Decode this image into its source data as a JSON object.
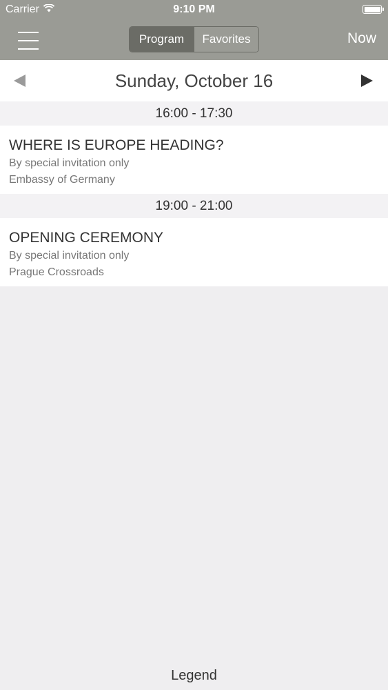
{
  "status_bar": {
    "carrier": "Carrier",
    "time": "9:10 PM",
    "wifi_icon": "wifi-icon",
    "battery_icon": "battery-icon"
  },
  "nav": {
    "menu_icon": "hamburger-menu-icon",
    "tabs": [
      {
        "label": "Program",
        "active": true
      },
      {
        "label": "Favorites",
        "active": false
      }
    ],
    "now_label": "Now"
  },
  "date_bar": {
    "title": "Sunday, October 16",
    "prev_icon": "triangle-left-icon",
    "next_icon": "triangle-right-icon"
  },
  "sessions": [
    {
      "time": "16:00 - 17:30",
      "events": [
        {
          "title": "WHERE IS EUROPE HEADING?",
          "access": "By special invitation only",
          "location": "Embassy of Germany"
        }
      ]
    },
    {
      "time": "19:00 - 21:00",
      "events": [
        {
          "title": "OPENING CEREMONY",
          "access": "By special invitation only",
          "location": "Prague Crossroads"
        }
      ]
    }
  ],
  "footer": {
    "legend_label": "Legend"
  },
  "colors": {
    "nav_background": "#9a9b95",
    "segment_active": "#6b6c66",
    "page_background": "#efeef0"
  }
}
